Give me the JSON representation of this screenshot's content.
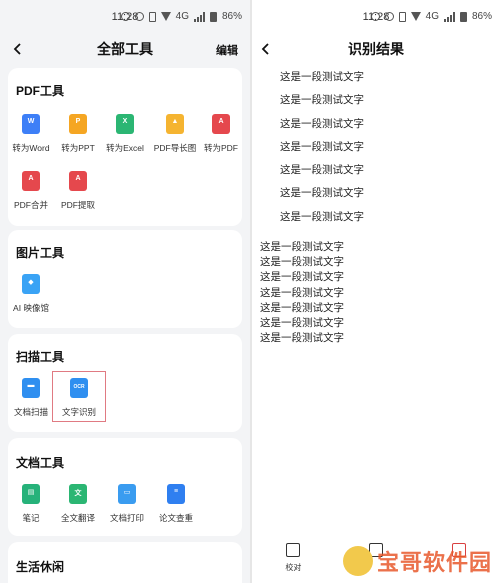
{
  "status": {
    "time": "11:28",
    "signal": "4G",
    "battery": "86%"
  },
  "left": {
    "nav": {
      "title": "全部工具",
      "edit": "编辑"
    },
    "sections": {
      "pdf": {
        "title": "PDF工具",
        "tools": [
          {
            "label": "转为Word",
            "icon": "word-icon",
            "color": "#3d7ff7",
            "glyph": "W"
          },
          {
            "label": "转为PPT",
            "icon": "ppt-icon",
            "color": "#f5a623",
            "glyph": "P"
          },
          {
            "label": "转为Excel",
            "icon": "excel-icon",
            "color": "#2bb673",
            "glyph": "X"
          },
          {
            "label": "PDF导长图",
            "icon": "long-image-icon",
            "color": "#f5b431",
            "glyph": "▲"
          },
          {
            "label": "转为PDF",
            "icon": "pdf-icon",
            "color": "#e5484d",
            "glyph": "A"
          },
          {
            "label": "PDF合并",
            "icon": "pdf-merge-icon",
            "color": "#e5484d",
            "glyph": "A"
          },
          {
            "label": "PDF提取",
            "icon": "pdf-extract-icon",
            "color": "#e5484d",
            "glyph": "A"
          }
        ]
      },
      "image": {
        "title": "图片工具",
        "tools": [
          {
            "label": "AI 映像馆",
            "icon": "ai-gallery-icon",
            "color": "#3aa3f5",
            "glyph": "◆"
          }
        ]
      },
      "scan": {
        "title": "扫描工具",
        "tools": [
          {
            "label": "文档扫描",
            "icon": "doc-scan-icon",
            "color": "#2f8ff0",
            "glyph": "▬"
          },
          {
            "label": "文字识别",
            "icon": "ocr-icon",
            "color": "#2f8ff0",
            "glyph": "OCR"
          }
        ]
      },
      "doc": {
        "title": "文档工具",
        "tools": [
          {
            "label": "笔记",
            "icon": "note-icon",
            "color": "#26b27a",
            "glyph": "▤"
          },
          {
            "label": "全文翻译",
            "icon": "translate-icon",
            "color": "#2bb673",
            "glyph": "文"
          },
          {
            "label": "文档打印",
            "icon": "print-icon",
            "color": "#3a9cf0",
            "glyph": "▭"
          },
          {
            "label": "论文查重",
            "icon": "paper-check-icon",
            "color": "#2f7ff0",
            "glyph": "≡"
          }
        ]
      },
      "life": {
        "title": "生活休闲"
      }
    }
  },
  "right": {
    "nav": {
      "title": "识别结果"
    },
    "result_top": [
      "这是一段测试文字",
      "这是一段测试文字",
      "这是一段测试文字",
      "这是一段测试文字",
      "这是一段测试文字",
      "这是一段测试文字",
      "这是一段测试文字"
    ],
    "result_bottom": [
      "这是一段测试文字",
      "这是一段测试文字",
      "这是一段测试文字",
      "这是一段测试文字",
      "这是一段测试文字",
      "这是一段测试文字",
      "这是一段测试文字"
    ],
    "bottom_bar": [
      {
        "label": "校对",
        "icon": "proofread-icon"
      },
      {
        "label": "",
        "icon": "copy-icon"
      },
      {
        "label": "",
        "icon": "export-icon"
      }
    ]
  },
  "watermark": {
    "text": "宝哥软件园"
  }
}
